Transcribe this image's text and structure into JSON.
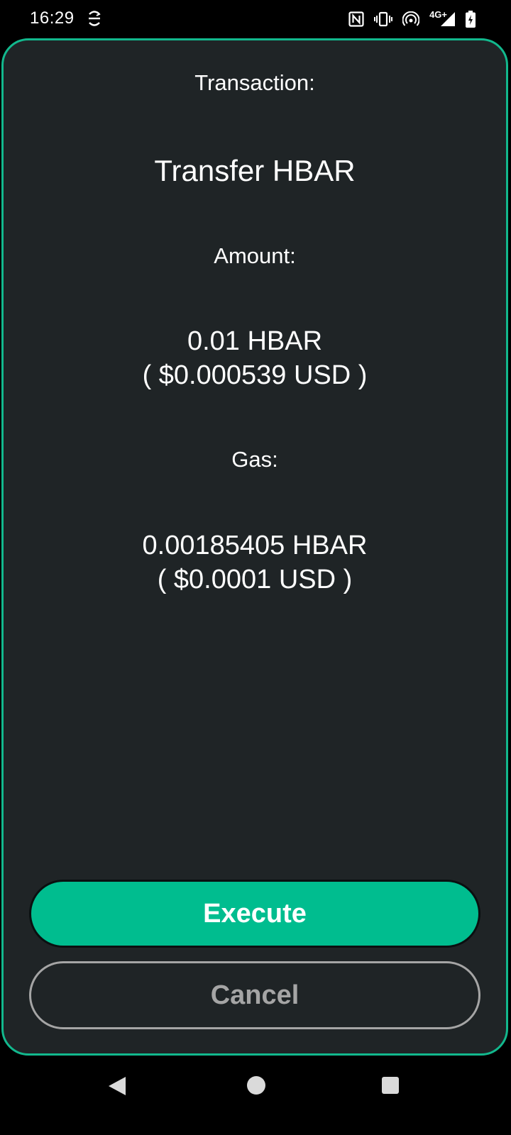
{
  "status_bar": {
    "time": "16:29",
    "network_label": "4G+",
    "icons": [
      "sync-icon",
      "nfc-icon",
      "vibrate-icon",
      "hotspot-icon",
      "signal-icon",
      "battery-icon"
    ]
  },
  "transaction": {
    "transaction_label": "Transaction:",
    "transaction_type": "Transfer HBAR",
    "amount_label": "Amount:",
    "amount_value": "0.01 HBAR",
    "amount_usd": "( $0.000539 USD )",
    "gas_label": "Gas:",
    "gas_value": "0.00185405 HBAR",
    "gas_usd": "( $0.0001 USD )"
  },
  "actions": {
    "execute_label": "Execute",
    "cancel_label": "Cancel"
  },
  "colors": {
    "accent": "#00bd8f",
    "card_border": "#12b88d",
    "card_background": "#1f2426",
    "cancel": "#a5a5a5"
  },
  "nav_bar": {
    "icons": [
      "back-icon",
      "home-icon",
      "recents-icon"
    ]
  }
}
